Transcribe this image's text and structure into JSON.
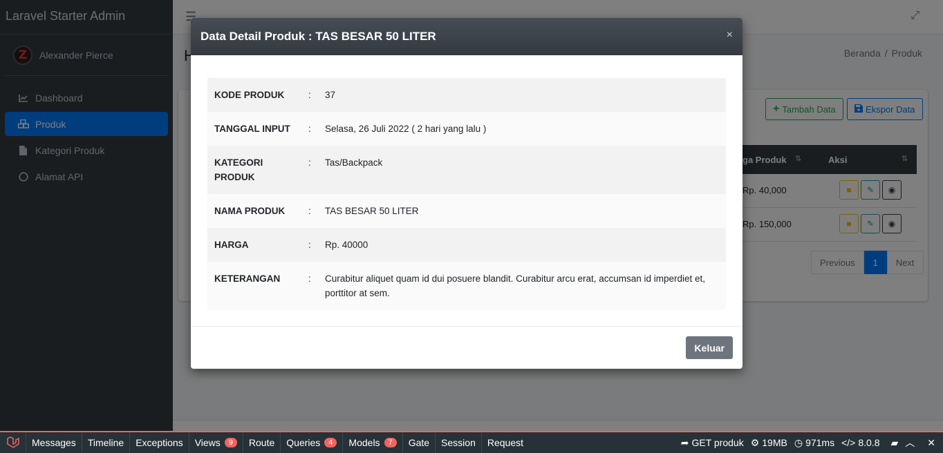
{
  "app": {
    "brand": "Laravel Starter Admin",
    "user_name": "Alexander Pierce",
    "avatar_letter": "Z"
  },
  "sidebar": {
    "items": [
      {
        "label": "Dashboard",
        "icon": "chart-icon"
      },
      {
        "label": "Produk",
        "icon": "cubes-icon",
        "active": true
      },
      {
        "label": "Kategori Produk",
        "icon": "file-icon"
      },
      {
        "label": "Alamat API",
        "icon": "circle-icon"
      }
    ]
  },
  "page": {
    "title_partial": "H",
    "breadcrumb": {
      "home": "Beranda",
      "sep": "/",
      "current": "Produk"
    }
  },
  "card": {
    "btn_tambah": "Tambah Data",
    "btn_ekspor": "Ekspor Data",
    "table": {
      "col_harga": "ga Produk",
      "col_aksi": "Aksi",
      "rows": [
        {
          "price": "Rp. 40,000"
        },
        {
          "price": "Rp. 150,000"
        }
      ]
    },
    "pager": {
      "prev": "Previous",
      "page": "1",
      "next": "Next"
    }
  },
  "modal": {
    "title": "Data Detail Produk : TAS BESAR 50 LITER",
    "close": "×",
    "rows": [
      {
        "label": "KODE PRODUK",
        "sep": ":",
        "value": "37"
      },
      {
        "label": "TANGGAL INPUT",
        "sep": ":",
        "value": "Selasa, 26 Juli 2022 ( 2 hari yang lalu )"
      },
      {
        "label": "KATEGORI PRODUK",
        "sep": ":",
        "value": "Tas/Backpack"
      },
      {
        "label": "NAMA PRODUK",
        "sep": ":",
        "value": "TAS BESAR 50 LITER"
      },
      {
        "label": "HARGA",
        "sep": ":",
        "value": "Rp. 40000"
      },
      {
        "label": "KETERANGAN",
        "sep": ":",
        "value": "Curabitur aliquet quam id dui posuere blandit. Curabitur arcu erat, accumsan id imperdiet et, porttitor at sem."
      }
    ],
    "btn_keluar": "Keluar"
  },
  "debugbar": {
    "tabs": [
      {
        "label": "Messages"
      },
      {
        "label": "Timeline"
      },
      {
        "label": "Exceptions"
      },
      {
        "label": "Views",
        "badge": "9"
      },
      {
        "label": "Route"
      },
      {
        "label": "Queries",
        "badge": "4"
      },
      {
        "label": "Models",
        "badge": "7"
      },
      {
        "label": "Gate"
      },
      {
        "label": "Session"
      },
      {
        "label": "Request"
      }
    ],
    "request": "GET produk",
    "memory": "19MB",
    "time": "971ms",
    "php": "8.0.8"
  },
  "colors": {
    "primary": "#007bff",
    "success": "#28a745",
    "warning": "#ffc107",
    "info": "#17a2b8",
    "sidebar": "#343a40",
    "debugbar": "#263238",
    "debug_accent": "#f4645f"
  }
}
